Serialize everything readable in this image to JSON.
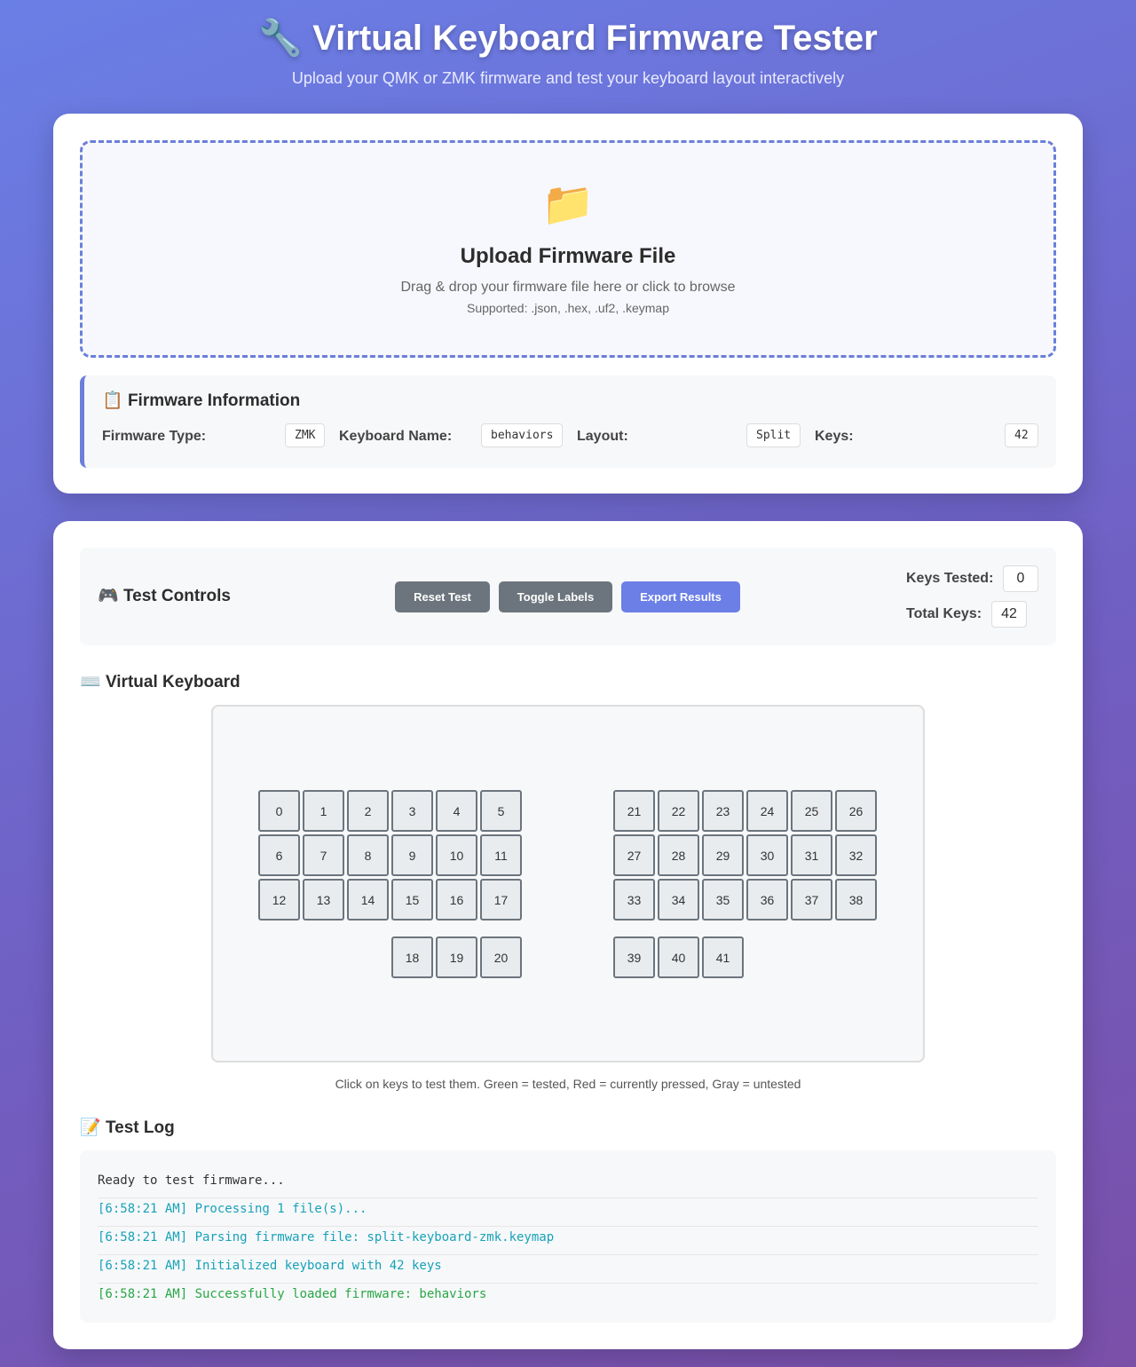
{
  "header": {
    "icon": "🔧",
    "title": "Virtual Keyboard Firmware Tester",
    "subtitle": "Upload your QMK or ZMK firmware and test your keyboard layout interactively"
  },
  "upload": {
    "icon": "📁",
    "title": "Upload Firmware File",
    "description": "Drag & drop your firmware file here or click to browse",
    "supported": "Supported: .json, .hex, .uf2, .keymap"
  },
  "firmware_info": {
    "icon": "📋",
    "title": "Firmware Information",
    "fields": [
      {
        "label": "Firmware Type:",
        "value": "ZMK"
      },
      {
        "label": "Keyboard Name:",
        "value": "behaviors"
      },
      {
        "label": "Layout:",
        "value": "Split"
      },
      {
        "label": "Keys:",
        "value": "42"
      }
    ]
  },
  "controls": {
    "icon": "🎮",
    "title": "Test Controls",
    "buttons": {
      "reset": "Reset Test",
      "toggle": "Toggle Labels",
      "export": "Export Results"
    },
    "keys_tested_label": "Keys Tested:",
    "keys_tested": "0",
    "total_keys_label": "Total Keys:",
    "total_keys": "42"
  },
  "keyboard": {
    "icon": "⌨️",
    "title": "Virtual Keyboard",
    "keys": [
      "0",
      "1",
      "2",
      "3",
      "4",
      "5",
      "6",
      "7",
      "8",
      "9",
      "10",
      "11",
      "12",
      "13",
      "14",
      "15",
      "16",
      "17",
      "18",
      "19",
      "20",
      "21",
      "22",
      "23",
      "24",
      "25",
      "26",
      "27",
      "28",
      "29",
      "30",
      "31",
      "32",
      "33",
      "34",
      "35",
      "36",
      "37",
      "38",
      "39",
      "40",
      "41"
    ],
    "hint": "Click on keys to test them. Green = tested, Red = currently pressed, Gray = untested"
  },
  "log": {
    "icon": "📝",
    "title": "Test Log",
    "entries": [
      {
        "text": "Ready to test firmware...",
        "type": "plain"
      },
      {
        "text": "[6:58:21 AM] Processing 1 file(s)...",
        "type": "info"
      },
      {
        "text": "[6:58:21 AM] Parsing firmware file: split-keyboard-zmk.keymap",
        "type": "info"
      },
      {
        "text": "[6:58:21 AM] Initialized keyboard with 42 keys",
        "type": "info"
      },
      {
        "text": "[6:58:21 AM] Successfully loaded firmware: behaviors",
        "type": "success"
      }
    ]
  },
  "colors": {
    "accent": "#6b7fe6",
    "untested": "#e9ecef",
    "info": "#17a2b8",
    "success": "#28a745"
  }
}
